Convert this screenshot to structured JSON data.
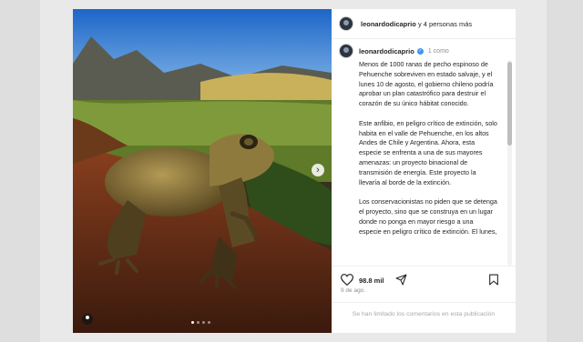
{
  "post": {
    "header": {
      "username": "leonardodicaprio",
      "collab_suffix": "y 4 personas más",
      "avatar_icon": "avatar-icon"
    },
    "caption": {
      "username": "leonardodicaprio",
      "time": "1 como",
      "text": "Menos de 1000 ranas de pecho espinoso de Pehuenche sobreviven en estado salvaje, y el lunes 10 de agosto, el gobierno chileno podría aprobar un plan catastrófico para destruir el corazón de su único hábitat conocido.\n\nEste anfibio, en peligro crítico de extinción, solo habita en el valle de Pehuenche, en los altos Andes de Chile y Argentina. Ahora, esta especie se enfrenta a una de sus mayores amenazas: un proyecto binacional de transmisión de energía. Este proyecto la llevaría al borde de la extinción.\n\nLos conservacionistas no piden que se detenga el proyecto, sino que se construya en un lugar donde no ponga en mayor riesgo a una especie en peligro crítico de extinción. El lunes,"
    },
    "actions": {
      "likes": "98.8 mil",
      "heart_icon": "heart-icon",
      "share_icon": "send-icon",
      "save_icon": "bookmark-icon"
    },
    "date": "9 de ago.",
    "comments_notice": "Se han limitado los comentarios en esta publicación",
    "carousel": {
      "next_icon": "chevron-right-icon",
      "total_slides": 4,
      "current_slide": 1
    }
  }
}
